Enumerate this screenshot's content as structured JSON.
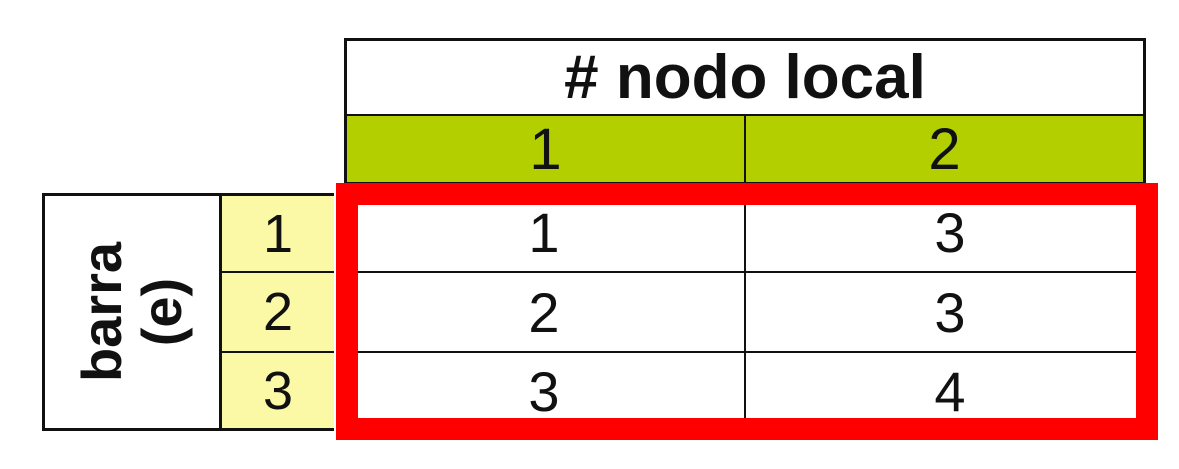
{
  "header": {
    "title": "# nodo local",
    "columns": [
      "1",
      "2"
    ]
  },
  "rows_label": {
    "line1": "barra",
    "line2": "(e)"
  },
  "rows": [
    {
      "label": "1",
      "values": [
        "1",
        "3"
      ]
    },
    {
      "label": "2",
      "values": [
        "2",
        "3"
      ]
    },
    {
      "label": "3",
      "values": [
        "3",
        "4"
      ]
    }
  ],
  "colors": {
    "header_bg": "#b3cf00",
    "row_label_bg": "#fbf8a6",
    "highlight": "#ff0000"
  }
}
